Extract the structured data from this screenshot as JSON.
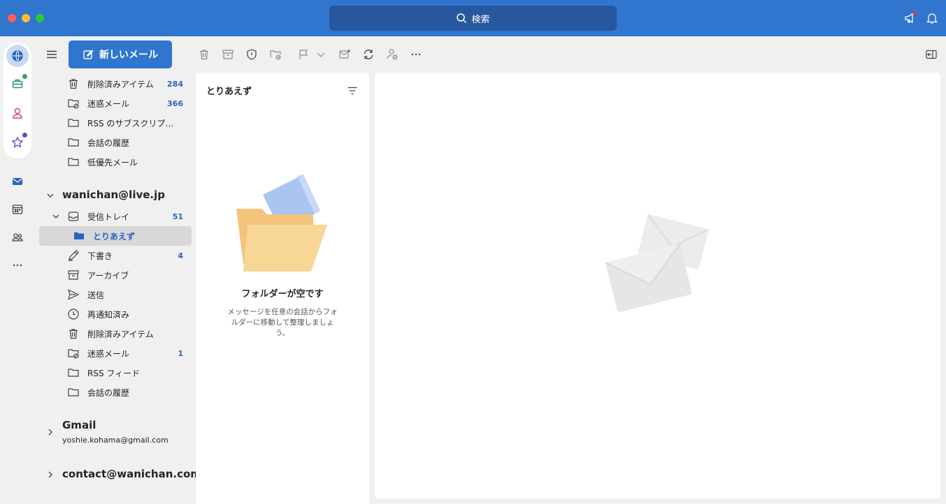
{
  "titlebar": {
    "search_placeholder": "検索"
  },
  "toolbar": {
    "new_mail_label": "新しいメール"
  },
  "folders_top": [
    {
      "label": "削除済みアイテム",
      "count": "284",
      "icon": "trash-icon"
    },
    {
      "label": "迷惑メール",
      "count": "366",
      "icon": "junk-folder-icon"
    },
    {
      "label": "RSS のサブスクリプション",
      "count": "",
      "icon": "folder-icon"
    },
    {
      "label": "会話の履歴",
      "count": "",
      "icon": "folder-icon"
    },
    {
      "label": "低優先メール",
      "count": "",
      "icon": "folder-icon"
    }
  ],
  "account1": {
    "name": "wanichan@live.jp",
    "folders": [
      {
        "label": "受信トレイ",
        "count": "51",
        "icon": "inbox-icon"
      },
      {
        "label": "とりあえず",
        "count": "",
        "icon": "folder-icon"
      },
      {
        "label": "下書き",
        "count": "4",
        "icon": "drafts-icon"
      },
      {
        "label": "アーカイブ",
        "count": "",
        "icon": "archive-icon"
      },
      {
        "label": "送信",
        "count": "",
        "icon": "send-icon"
      },
      {
        "label": "再通知済み",
        "count": "",
        "icon": "clock-icon"
      },
      {
        "label": "削除済みアイテム",
        "count": "",
        "icon": "trash-icon"
      },
      {
        "label": "迷惑メール",
        "count": "1",
        "icon": "junk-folder-icon"
      },
      {
        "label": "RSS フィード",
        "count": "",
        "icon": "folder-icon"
      },
      {
        "label": "会話の履歴",
        "count": "",
        "icon": "folder-icon"
      }
    ]
  },
  "account2": {
    "name": "Gmail",
    "email": "yoshie.kohama@gmail.com"
  },
  "account3": {
    "name": "contact@wanichan.com"
  },
  "message_list": {
    "title": "とりあえず",
    "empty_title": "フォルダーが空です",
    "empty_desc": "メッセージを任意の会話からフォルダーに移動して整理しましょう。"
  },
  "colors": {
    "accent": "#3076cf",
    "count_text": "#2864c0"
  }
}
